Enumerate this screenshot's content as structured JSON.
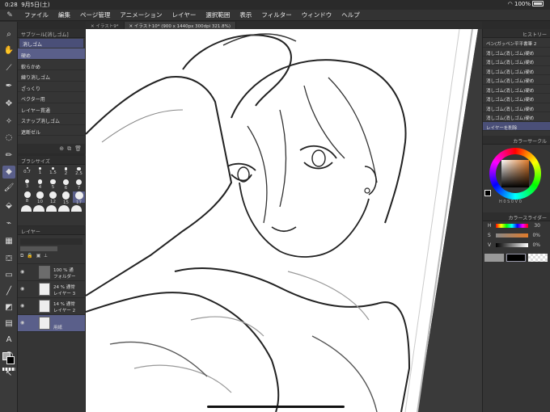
{
  "status": {
    "time": "0:28",
    "date": "9月5日(土)",
    "battery": "100%"
  },
  "menu": [
    "ファイル",
    "編集",
    "ページ管理",
    "アニメーション",
    "レイヤー",
    "選択範囲",
    "表示",
    "フィルター",
    "ウィンドウ",
    "ヘルプ"
  ],
  "tabs": {
    "first": "イラスト9*",
    "second": "イラスト10* (900 x 1440px 300dpi 321.8%)"
  },
  "subtool": {
    "title": "サブツール[消しゴム]",
    "group": "消しゴム",
    "items": [
      "硬め",
      "軟らかめ",
      "練り消しゴム",
      "ざっくり",
      "ベクター用",
      "レイヤー貫通",
      "スナップ消しゴム",
      "遮断ゼル"
    ],
    "selected_index": 0
  },
  "brushsize": {
    "title": "ブラシサイズ",
    "values": [
      "0.7",
      "1",
      "1.5",
      "2",
      "2.5",
      "3",
      "4",
      "5",
      "6",
      "7",
      "8",
      "10",
      "12",
      "15",
      "17"
    ],
    "selected": "17"
  },
  "layers": {
    "title": "レイヤー",
    "items": [
      {
        "line1": "100 % 通",
        "line2": "フォルダー",
        "type": "folder"
      },
      {
        "line1": "24 % 通常",
        "line2": "レイヤー 3",
        "type": "raster"
      },
      {
        "line1": "14 % 通常",
        "line2": "レイヤー 2",
        "type": "raster"
      },
      {
        "line1": "",
        "line2": "用紙",
        "type": "paper"
      }
    ]
  },
  "history": {
    "title": "ヒストリー",
    "items": [
      "ペン(ガッペン平平書筆 2",
      "消しゴム(消しゴム)硬め",
      "消しゴム(消しゴム)硬め",
      "消しゴム(消しゴム)硬め",
      "消しゴム(消しゴム)硬め",
      "消しゴム(消しゴム)硬め",
      "消しゴム(消しゴム)硬め",
      "消しゴム(消しゴム)硬め",
      "消しゴム(消しゴム)硬め",
      "レイヤーを削除"
    ],
    "selected_index": 9
  },
  "color_circle": {
    "title": "カラーサークル",
    "h": "0",
    "s": "0",
    "v": "0"
  },
  "color_slider": {
    "title": "カラースライダー",
    "rows": [
      {
        "label": "H",
        "value": "30"
      },
      {
        "label": "S",
        "value": "0%"
      },
      {
        "label": "V",
        "value": "0%"
      }
    ]
  },
  "colors": {
    "main": "#000000",
    "accent": "#5a5f8a"
  }
}
